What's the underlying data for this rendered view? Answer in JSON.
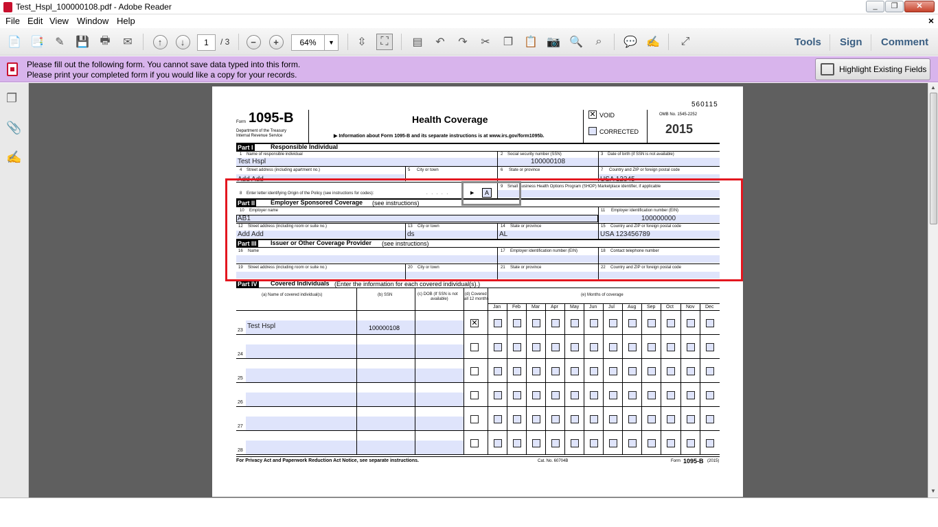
{
  "window": {
    "title": "Test_Hspl_100000108.pdf - Adobe Reader",
    "min": "_",
    "max": "❐",
    "close": "✕"
  },
  "menu": {
    "items": [
      "File",
      "Edit",
      "View",
      "Window",
      "Help"
    ],
    "close": "×"
  },
  "toolbar": {
    "page_current": "1",
    "page_total": "/ 3",
    "zoom": "64%",
    "tools": "Tools",
    "sign": "Sign",
    "comment": "Comment"
  },
  "notification": {
    "line1": "Please fill out the following form. You cannot save data typed into this form.",
    "line2": "Please print your completed form if you would like a copy for your records.",
    "button": "Highlight Existing Fields"
  },
  "form": {
    "code": "560115",
    "form_word": "Form",
    "form_number": "1095-B",
    "title": "Health Coverage",
    "dept1": "Department of the Treasury",
    "dept2": "Internal Revenue Service",
    "info_line": "▶ Information about Form 1095-B and its separate instructions is at www.irs.gov/form1095b.",
    "void_label": "VOID",
    "void_mark": "✕",
    "corrected_label": "CORRECTED",
    "omb": "OMB No. 1545-2252",
    "year": "2015",
    "part1": {
      "tag": "Part I",
      "title": "Responsible Individual"
    },
    "f1": {
      "num": "1",
      "label": "Name of responsible individual",
      "value": "Test Hspl"
    },
    "f2": {
      "num": "2",
      "label": "Social security number (SSN)",
      "value": "100000108"
    },
    "f3": {
      "num": "3",
      "label": "Date of birth (if SSN is not available)"
    },
    "f4": {
      "num": "4",
      "label": "Street address (including apartment no.)",
      "value": "Add Add"
    },
    "f5": {
      "num": "5",
      "label": "City or town"
    },
    "f6": {
      "num": "6",
      "label": "State or province"
    },
    "f7": {
      "num": "7",
      "label": "Country and ZIP or foreign postal code",
      "value": "USA 12345"
    },
    "f8": {
      "num": "8",
      "label": "Enter letter identifying Origin of the Policy (see instructions for codes):",
      "dots": ". . . . .",
      "arrow": "▶",
      "value": "A"
    },
    "f9": {
      "num": "9",
      "label": "Small Business Health Options Program (SHOP) Marketplace identifier, if applicable"
    },
    "part2": {
      "tag": "Part II",
      "title": "Employer Sponsored Coverage",
      "note": "(see instructions)"
    },
    "f10": {
      "num": "10",
      "label": "Employer name",
      "value": "AB1"
    },
    "f11": {
      "num": "11",
      "label": "Employer identification number (EIN)",
      "value": "100000000"
    },
    "f12": {
      "num": "12",
      "label": "Street address (including room or suite no.)",
      "value": "Add Add"
    },
    "f13": {
      "num": "13",
      "label": "City or town",
      "value": "ds"
    },
    "f14": {
      "num": "14",
      "label": "State or province",
      "value": "AL"
    },
    "f15": {
      "num": "15",
      "label": "Country and ZIP or foreign postal code",
      "value": "USA 123456789"
    },
    "part3": {
      "tag": "Part III",
      "title": "Issuer or Other Coverage Provider",
      "note": "(see instructions)"
    },
    "f16": {
      "num": "16",
      "label": "Name"
    },
    "f17": {
      "num": "17",
      "label": "Employer identification number (EIN)"
    },
    "f18": {
      "num": "18",
      "label": "Contact telephone number"
    },
    "f19": {
      "num": "19",
      "label": "Street address (including room or suite no.)"
    },
    "f20": {
      "num": "20",
      "label": "City or town"
    },
    "f21": {
      "num": "21",
      "label": "State or province"
    },
    "f22": {
      "num": "22",
      "label": "Country and ZIP or foreign postal code"
    },
    "part4": {
      "tag": "Part IV",
      "title": "Covered Individuals",
      "note": "(Enter the information for each covered individual(s).)"
    },
    "cols": {
      "a": "(a) Name of covered individual(s)",
      "b": "(b) SSN",
      "c1": "(c) DOB (If SSN is not",
      "c2": "available)",
      "d1": "(d) Covered",
      "d2": "all 12 months",
      "e": "(e) Months of coverage"
    },
    "months": [
      "Jan",
      "Feb",
      "Mar",
      "Apr",
      "May",
      "Jun",
      "Jul",
      "Aug",
      "Sep",
      "Oct",
      "Nov",
      "Dec"
    ],
    "rows": [
      {
        "num": "23",
        "name": "Test Hspl",
        "ssn": "100000108",
        "covered_all": "✕"
      },
      {
        "num": "24",
        "name": "",
        "ssn": "",
        "covered_all": ""
      },
      {
        "num": "25",
        "name": "",
        "ssn": "",
        "covered_all": ""
      },
      {
        "num": "26",
        "name": "",
        "ssn": "",
        "covered_all": ""
      },
      {
        "num": "27",
        "name": "",
        "ssn": "",
        "covered_all": ""
      },
      {
        "num": "28",
        "name": "",
        "ssn": "",
        "covered_all": ""
      }
    ],
    "footer_left": "For Privacy Act and Paperwork Reduction Act Notice, see separate instructions.",
    "footer_cat": "Cat. No. 60704B",
    "footer_form": "Form",
    "footer_num": "1095-B",
    "footer_year": "(2015)"
  },
  "colors": {
    "highlight": "#e3161f",
    "gray_highlight": "#888888",
    "field_fill": "#dfe4fb",
    "notif": "#d8b4ec"
  }
}
